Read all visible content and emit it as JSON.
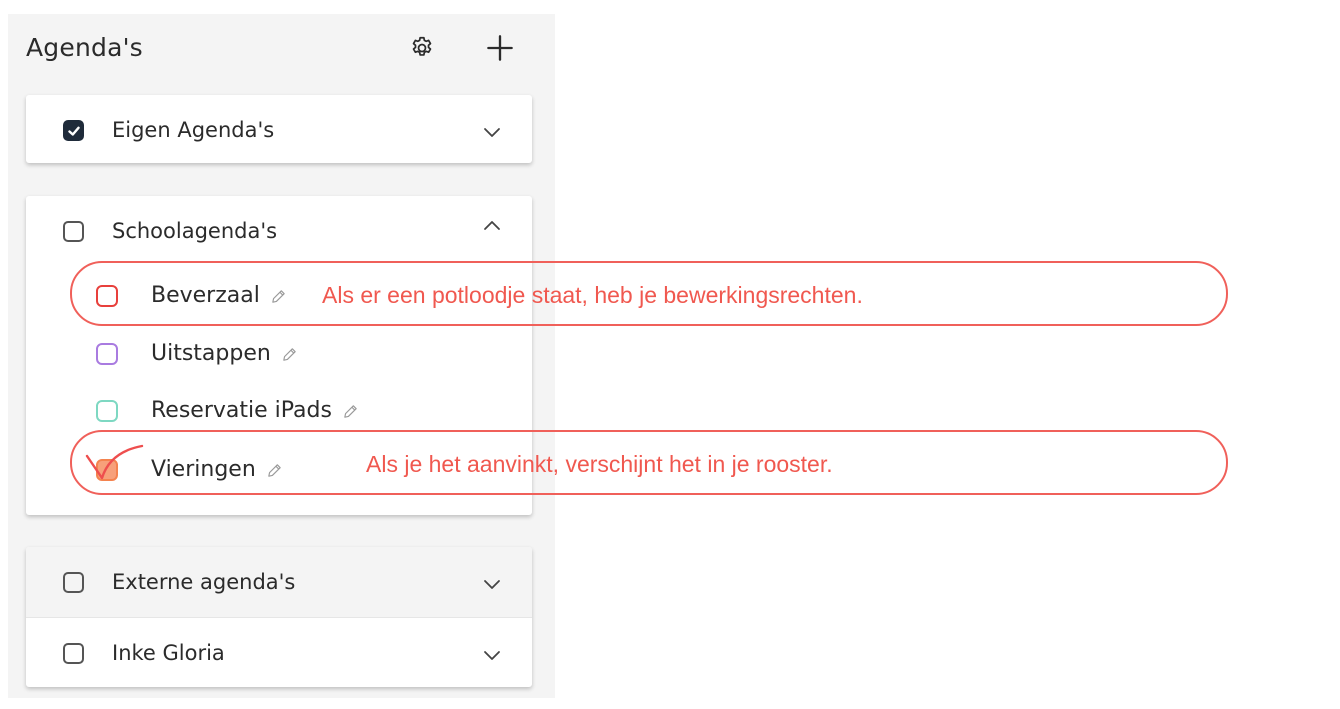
{
  "header": {
    "title": "Agenda's",
    "settings_icon": "gear-icon",
    "add_icon": "plus-icon"
  },
  "groups": [
    {
      "label": "Eigen Agenda's",
      "checked": true,
      "expanded": false
    },
    {
      "label": "Schoolagenda's",
      "checked": false,
      "expanded": true,
      "items": [
        {
          "label": "Beverzaal",
          "color": "#e8403c",
          "checked": false,
          "editable": true
        },
        {
          "label": "Uitstappen",
          "color": "#a97be0",
          "checked": false,
          "editable": true
        },
        {
          "label": "Reservatie iPads",
          "color": "#7ed8c2",
          "checked": false,
          "editable": true
        },
        {
          "label": "Vieringen",
          "color": "#f4834f",
          "checked": true,
          "editable": true
        }
      ]
    },
    {
      "label": "Externe agenda's",
      "checked": false,
      "expanded": false
    },
    {
      "label": "Inke Gloria",
      "checked": false,
      "expanded": false
    }
  ],
  "annotations": [
    {
      "text": "Als er een potloodje staat, heb je bewerkingsrechten."
    },
    {
      "text": "Als je het aanvinkt, verschijnt het in je rooster."
    }
  ],
  "colors": {
    "annotation": "#f0584f",
    "panel_bg": "#f4f4f4",
    "checked_fill": "#1f2b3a"
  }
}
